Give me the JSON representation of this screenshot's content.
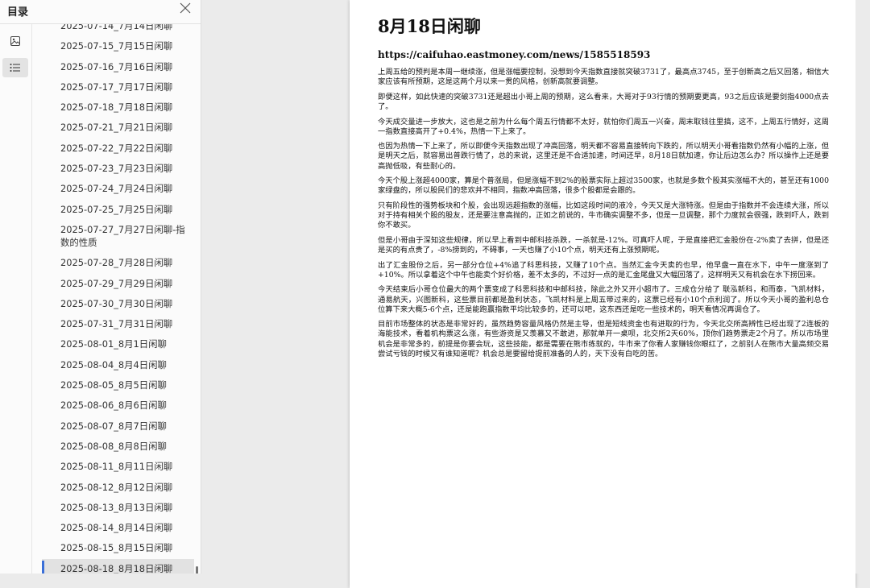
{
  "sidebar": {
    "title": "目录",
    "close_icon": "close-icon",
    "rail": [
      {
        "name": "thumbnail-view-icon",
        "active": false
      },
      {
        "name": "outline-view-icon",
        "active": true
      }
    ],
    "items": [
      {
        "label": "2025-07-14_7月14日闲聊"
      },
      {
        "label": "2025-07-15_7月15日闲聊"
      },
      {
        "label": "2025-07-16_7月16日闲聊"
      },
      {
        "label": "2025-07-17_7月17日闲聊"
      },
      {
        "label": "2025-07-18_7月18日闲聊"
      },
      {
        "label": "2025-07-21_7月21日闲聊"
      },
      {
        "label": "2025-07-22_7月22日闲聊"
      },
      {
        "label": "2025-07-23_7月23日闲聊"
      },
      {
        "label": "2025-07-24_7月24日闲聊"
      },
      {
        "label": "2025-07-25_7月25日闲聊"
      },
      {
        "label": "2025-07-27_7月27日闲聊-指数的性质"
      },
      {
        "label": "2025-07-28_7月28日闲聊"
      },
      {
        "label": "2025-07-29_7月29日闲聊"
      },
      {
        "label": "2025-07-30_7月30日闲聊"
      },
      {
        "label": "2025-07-31_7月31日闲聊"
      },
      {
        "label": "2025-08-01_8月1日闲聊"
      },
      {
        "label": "2025-08-04_8月4日闲聊"
      },
      {
        "label": "2025-08-05_8月5日闲聊"
      },
      {
        "label": "2025-08-06_8月6日闲聊"
      },
      {
        "label": "2025-08-07_8月7日闲聊"
      },
      {
        "label": "2025-08-08_8月8日闲聊"
      },
      {
        "label": "2025-08-11_8月11日闲聊"
      },
      {
        "label": "2025-08-12_8月12日闲聊"
      },
      {
        "label": "2025-08-13_8月13日闲聊"
      },
      {
        "label": "2025-08-14_8月14日闲聊"
      },
      {
        "label": "2025-08-15_8月15日闲聊"
      },
      {
        "label": "2025-08-18_8月18日闲聊",
        "selected": true
      }
    ],
    "accent_color": "#3a6fd8"
  },
  "document": {
    "title": "8月18日闲聊",
    "url": "https://caifuhao.eastmoney.com/news/1585518593",
    "paragraphs": [
      "上周五给的预判是本周一继续涨，但是涨幅要控制，没想到今天指数直接就突破3731了，最高点3745，至于创新高之后又回落，相信大家应该有所预期，这是这两个月以来一贯的风格，创新高就要调整。",
      "即便这样，如此快速的突破3731还是超出小哥上周的预期，这么看来，大哥对于93行情的预期要更高，93之后应该是要剑指4000点去了。",
      "今天成交量进一步放大，这也是之前为什么每个周五行情都不太好，就怕你们周五一兴奋，周末取钱往里搞，这不，上周五行情好，这周一指数直接高开了+0.4%，热情一下上来了。",
      "也因为热情一下上来了，所以即便今天指数出现了冲高回落，明天都不容易直接转向下跌的，所以明天小哥看指数仍然有小幅的上涨，但是明天之后，就容易出普跌行情了，总的来说，这里还是不合适加速，时间还早，8月18日就加速，你让后边怎么办？所以操作上还是要高抛低吸，有些耐心的。",
      "今天个股上涨超4000家，算是个普涨局，但是涨幅不到2%的股票实际上超过3500家，也就是多数个股其实涨幅不大的，甚至还有1000家绿盘的，所以股民们的悲欢并不相同，指数冲高回落，很多个股都是会跟的。",
      "只有阶段性的强势板块和个股，会出现远超指数的涨幅，比如这段时间的液冷，今天又是大涨特涨。但是由于指数并不会连续大涨，所以对于持有相关个股的股友，还是要注意高抛的，正如之前说的，牛市确实调整不多，但是一旦调整，那个力度就会很强，跌到吓人，跌到你不敢买。",
      "但是小哥由于深知这些规律，所以早上看到中邮科技杀跌，一杀就是-12%。可真吓人呢，于是直接把汇金股份在-2%卖了去拼，但是还是买的有点贵了，-8%捞到的，不碍事，一天也赚了小10个点，明天还有上涨预期呢。",
      "出了汇金股份之后，另一部分仓位+4%追了科思科技，又赚了10个点。当然汇金今天卖的也早，他早盘一直在水下，中午一度涨到了+10%。所以拿着这个中午也能卖个好价格，差不太多的，不过好一点的是汇金尾盘又大幅回落了，这样明天又有机会在水下捞回来。",
      "今天结束后小哥仓位最大的两个票变成了科思科技和中邮科技，除此之外又开小超市了。三成仓分给了 联泓新科，和而泰，飞凯材料，通易航天，兴图新科，这些票目前都是盈利状态，飞凯材料是上周五带过来的，这票已经有小10个点利润了。所以今天小哥的盈利总仓位算下来大概5-6个点，还是能跑赢指数平均比较多的，还可以吧，这东西还是吃一些技术的，明天看情况再调仓了。",
      "目前市场整体的状态是非常好的，虽然趋势容量风格仍然是主导，但是短线资金也有进取的行为，今天北交所高辨性已经出现了2连板的海能技术，看着机构票这么涨，有些游资是又羡慕又不敢进，那就单开一桌呗，北交所2天60%，顶你们趋势票走2个月了。所以市场里机会是非常多的，前提是你要会玩，这些技能，都是需要在熊市练就的，牛市来了你看人家赚钱你眼红了，之前别人在熊市大量高频交易尝试亏钱的时候又有谁知道呢？机会总是要留给提前准备的人的，天下没有白吃的苦。"
    ]
  }
}
